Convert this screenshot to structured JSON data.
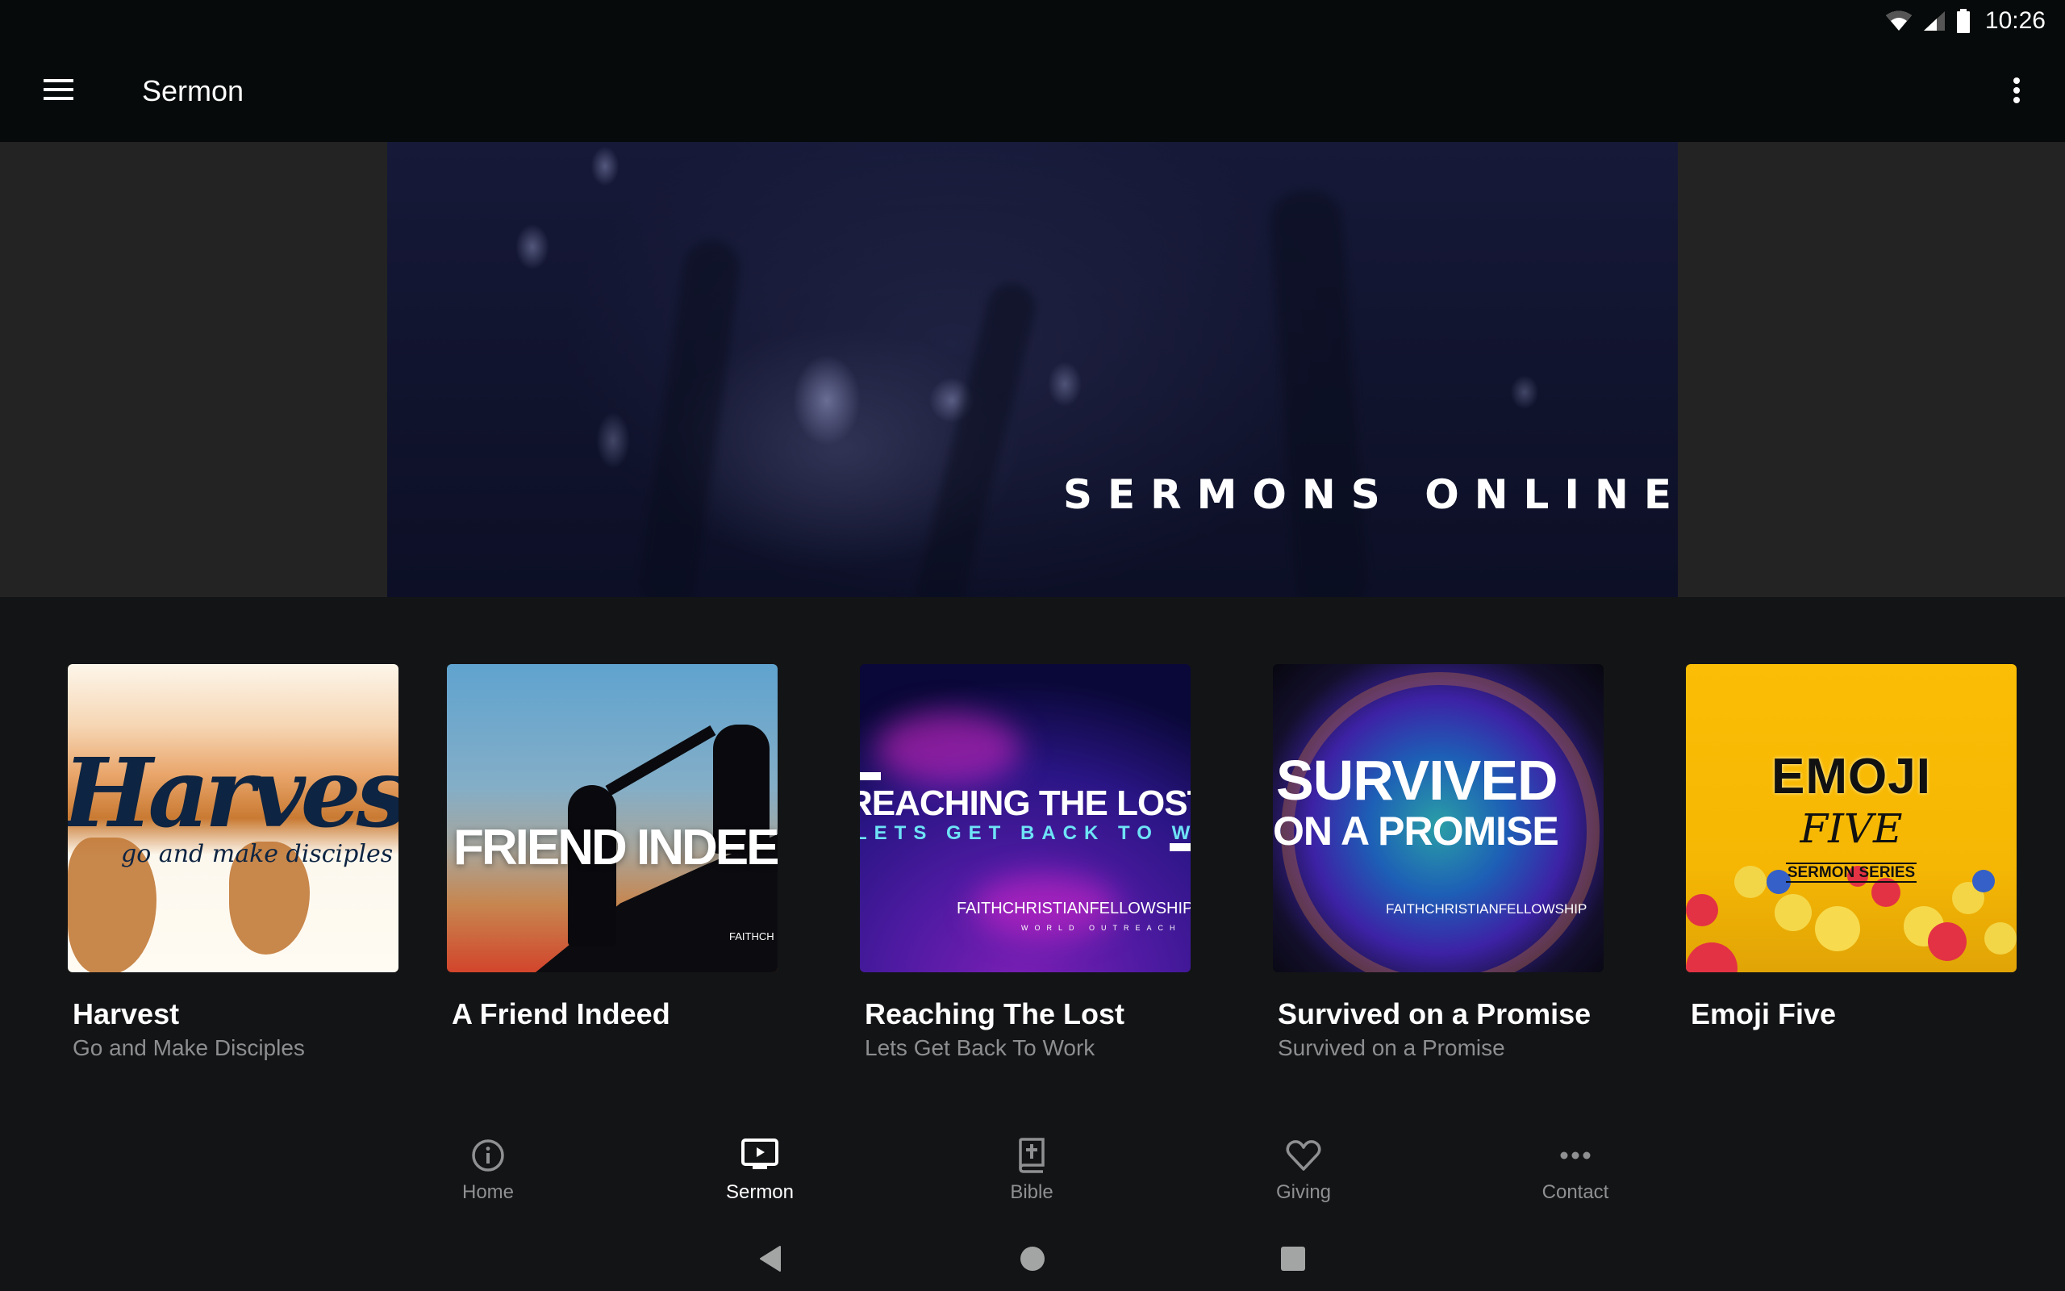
{
  "status_bar": {
    "time": "10:26",
    "icons": [
      "wifi-icon",
      "cell-signal-icon",
      "battery-icon"
    ]
  },
  "app_bar": {
    "title": "Sermon",
    "menu_icon": "hamburger-menu-icon",
    "overflow_icon": "more-vert-icon"
  },
  "banner": {
    "text": "SERMONS ONLINE"
  },
  "sermons": [
    {
      "title": "Harvest",
      "subtitle": "Go and Make Disciples",
      "art": {
        "headline": "Harvest",
        "tagline": "go and make disciples"
      }
    },
    {
      "title": "A Friend Indeed",
      "subtitle": "",
      "art": {
        "headline": "FRIEND INDEE",
        "logo": "FAITHCH"
      }
    },
    {
      "title": "Reaching The Lost",
      "subtitle": "Lets Get Back To Work",
      "art": {
        "headline": "REACHING THE LOST",
        "tagline": "LETS GET BACK TO WORK",
        "logo": "FAITHCHRISTIANFELLOWSHIP",
        "logo_sub": "WORLD OUTREACH"
      }
    },
    {
      "title": "Survived on a Promise",
      "subtitle": "Survived on a Promise",
      "art": {
        "headline": "SURVIVED",
        "headline2": "ON A PROMISE",
        "logo": "FAITHCHRISTIANFELLOWSHIP"
      }
    },
    {
      "title": "Emoji Five",
      "subtitle": "",
      "art": {
        "headline": "EMOJI",
        "headline2": "FIVE",
        "tagline": "SERMON SERIES"
      }
    }
  ],
  "bottom_nav": [
    {
      "label": "Home",
      "icon": "info-circle-icon",
      "active": false
    },
    {
      "label": "Sermon",
      "icon": "tv-play-icon",
      "active": true
    },
    {
      "label": "Bible",
      "icon": "bible-icon",
      "active": false
    },
    {
      "label": "Giving",
      "icon": "heart-icon",
      "active": false
    },
    {
      "label": "Contact",
      "icon": "more-horiz-icon",
      "active": false
    }
  ],
  "system_nav": [
    "back",
    "home",
    "recents"
  ],
  "colors": {
    "app_bar_bg": "#060a0a",
    "content_bg": "#131416",
    "banner_side_bg": "#232323",
    "active_nav": "#ffffff",
    "inactive_nav": "#8f9092",
    "subtitle": "#8d8e90"
  }
}
